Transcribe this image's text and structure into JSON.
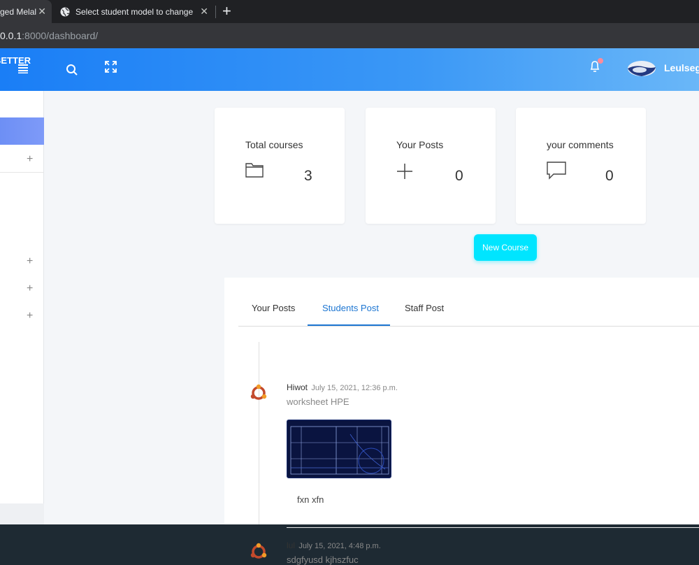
{
  "browser": {
    "tabs": [
      {
        "label": "ged Melal",
        "close": "✕"
      },
      {
        "label": "Select student model to change |",
        "close": "✕"
      }
    ],
    "new_tab": "+",
    "url_host": "0.0.1",
    "url_path": ":8000/dashboard/"
  },
  "header": {
    "brand": "BETTER",
    "user_name": "Leulseg",
    "icons": [
      "menu-icon",
      "search-icon",
      "fullscreen-icon",
      "bell-icon"
    ]
  },
  "sidebar": {
    "expand_symbol": "+"
  },
  "stats": [
    {
      "title": "Total courses",
      "value": "3",
      "icon": "folder-icon"
    },
    {
      "title": "Your Posts",
      "value": "0",
      "icon": "plus-icon"
    },
    {
      "title": "your comments",
      "value": "0",
      "icon": "comment-icon"
    }
  ],
  "new_course_label": "New Course",
  "post_tabs": [
    {
      "label": "Your Posts"
    },
    {
      "label": "Students Post"
    },
    {
      "label": "Staff Post"
    }
  ],
  "posts": [
    {
      "author": "Hiwot",
      "date": "July 15, 2021, 12:36 p.m.",
      "title": "worksheet HPE",
      "body": "fxn xfn"
    },
    {
      "author": "lul",
      "date": "July 15, 2021, 4:48 p.m.",
      "title": "sdgfyusd kjhszfuc"
    }
  ],
  "colors": {
    "header_start": "#1a7ef6",
    "accent": "#1d76d2",
    "button": "#00e5ff"
  }
}
